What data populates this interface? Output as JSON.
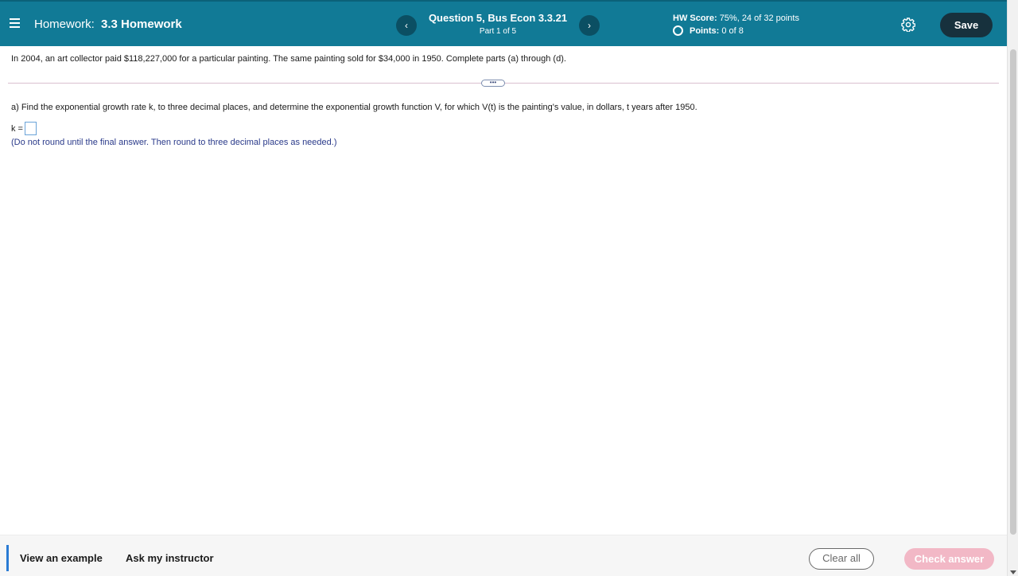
{
  "header": {
    "homework_label": "Homework:",
    "homework_name": "3.3 Homework",
    "prev_label": "‹",
    "next_label": "›",
    "question_title": "Question 5, Bus Econ 3.3.21",
    "question_part": "Part 1 of 5",
    "score_label": "HW Score:",
    "score_value": "75%, 24 of 32 points",
    "points_label": "Points:",
    "points_value": "0 of 8",
    "save_label": "Save"
  },
  "content": {
    "problem_text": "In 2004, an art collector paid $118,227,000 for a particular painting. The same painting sold for $34,000 in 1950. Complete parts (a) through (d).",
    "expand_label": "•••",
    "part_a_text": "a) Find the exponential growth rate k, to three decimal places, and determine the exponential growth function V, for which V(t) is the painting's value, in dollars, t years after 1950.",
    "answer_label": "k =",
    "answer_value": "",
    "hint_text": "(Do not round until the final answer. Then round to three decimal places as needed.)"
  },
  "footer": {
    "view_example_label": "View an example",
    "ask_instructor_label": "Ask my instructor",
    "clear_all_label": "Clear all",
    "check_answer_label": "Check answer"
  },
  "colors": {
    "header_bg": "#117a96",
    "save_bg": "#17313d",
    "check_answer_bg": "#f2b8c6",
    "hint_text": "#2a3a8a"
  },
  "icons": {
    "menu": "menu-icon",
    "gear": "gear-icon",
    "points_status": "circle-icon"
  }
}
